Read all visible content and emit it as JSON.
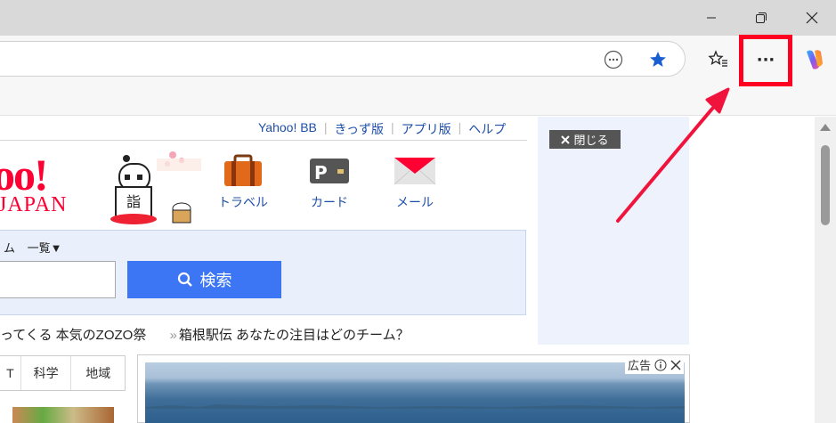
{
  "window": {
    "minimize_icon": "minimize-icon",
    "restore_icon": "restore-icon",
    "close_icon": "close-icon"
  },
  "toolbar": {
    "more_options_label": "···",
    "icons": [
      "more-tools-icon",
      "favorite-star-icon",
      "favorites-list-icon",
      "settings-more-icon",
      "copilot-icon"
    ]
  },
  "yahoo": {
    "top_links": [
      "Yahoo! BB",
      "きっず版",
      "アプリ版",
      "ヘルプ"
    ],
    "logo_main": "oo!",
    "logo_sub": "JAPAN",
    "services": [
      {
        "label": "トラベル",
        "icon": "suitcase-icon"
      },
      {
        "label": "カード",
        "icon": "card-icon"
      },
      {
        "label": "メール",
        "icon": "mail-icon"
      }
    ],
    "search_category": "ム",
    "search_list": "一覧▼",
    "search_input_value": "",
    "search_button": "検索",
    "topic_1": "ってくる 本気のZOZO祭",
    "topic_2": "箱根駅伝 あなたの注目はどのチーム？",
    "topic_arrow": "»",
    "tabs": [
      "T",
      "科学",
      "地域"
    ],
    "ad_label": "広告",
    "close_ad": "閉じる"
  },
  "colors": {
    "highlight": "#ff0022",
    "yahoo_red": "#ff0033",
    "search_button": "#3d76f5",
    "link_blue": "#1e4fa8"
  }
}
